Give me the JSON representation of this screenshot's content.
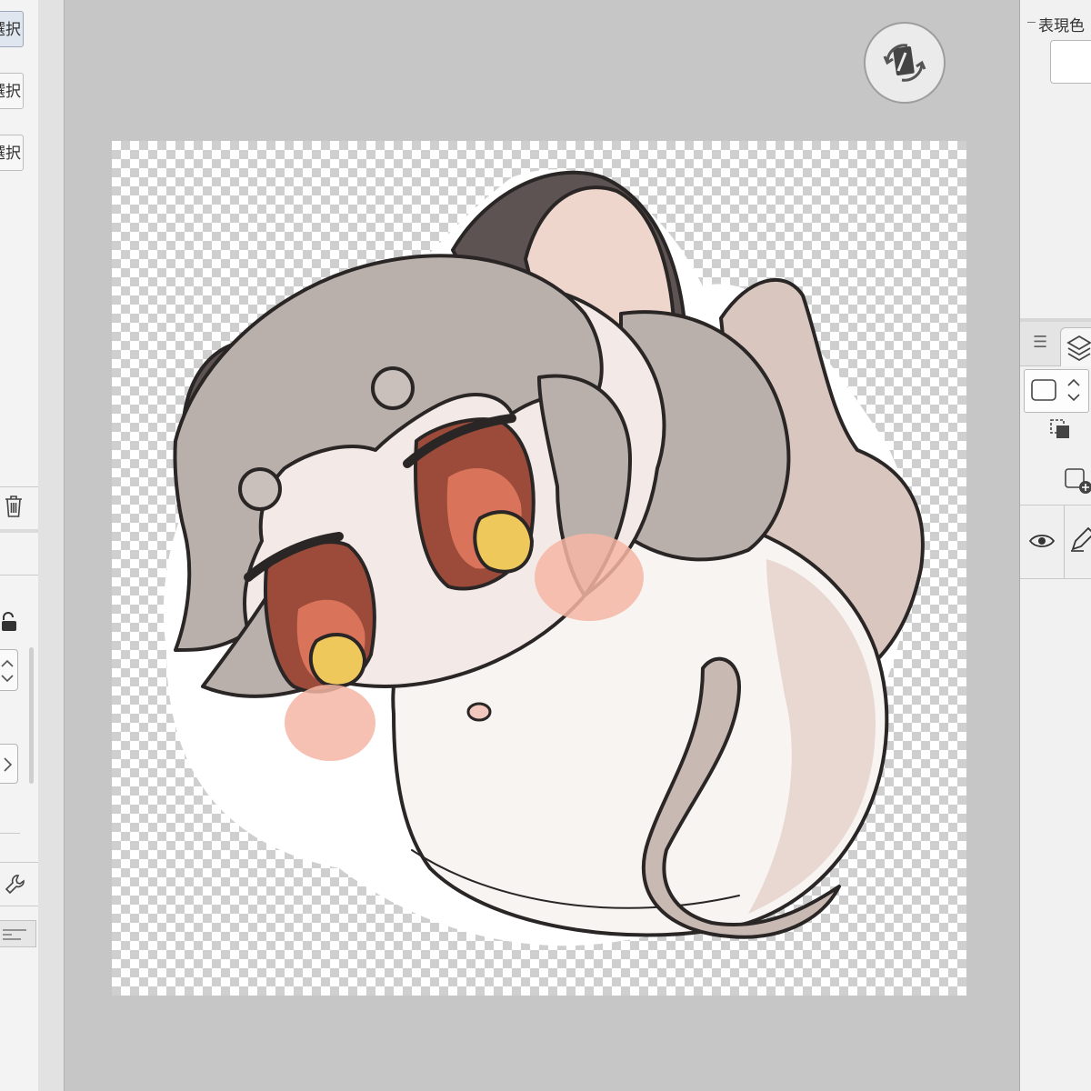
{
  "left_panel": {
    "selection_buttons": [
      "選択",
      "選択",
      "選択"
    ]
  },
  "color_panel": {
    "title": "表現色"
  },
  "colors": {
    "workspace": "#c6c6c6",
    "panel": "#f3f3f3",
    "hair": "#bab0ab",
    "skin": "#f3e9e6",
    "eye_outer": "#9c4b3a",
    "eye_iris": "#d9745b",
    "eye_highlight": "#eec85a",
    "blush": "#f4b6a4",
    "ear_inner": "#efd6cc",
    "ear_dark": "#5e5353",
    "body": "#f7f4f2",
    "tail": "#c8b9b3",
    "outline": "#2a2626"
  },
  "icons": {
    "rotate": "rotate-canvas-icon",
    "trash": "trash-icon",
    "lock": "lock-icon",
    "wrench": "wrench-icon",
    "layers": "layers-icon",
    "eye": "eye-icon",
    "pen": "pen-icon"
  }
}
